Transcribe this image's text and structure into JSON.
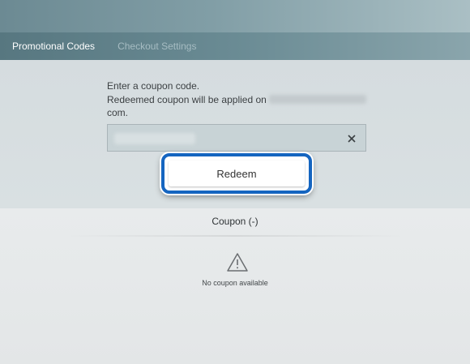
{
  "tabs": [
    {
      "label": "Promotional Codes",
      "active": true
    },
    {
      "label": "Checkout Settings",
      "active": false
    }
  ],
  "form": {
    "instruction_line1": "Enter a coupon code.",
    "instruction_line2_prefix": "Redeemed coupon will be applied on",
    "instruction_line3": "com.",
    "input_value": "",
    "redeem_label": "Redeem"
  },
  "coupons": {
    "header": "Coupon (-)",
    "empty_message": "No coupon available"
  },
  "icons": {
    "clear": "close-icon",
    "empty_state": "warning-triangle-icon"
  },
  "colors": {
    "focus_ring": "#1565c0",
    "tab_active": "#ffffff",
    "tab_inactive": "#a6bcc2"
  }
}
